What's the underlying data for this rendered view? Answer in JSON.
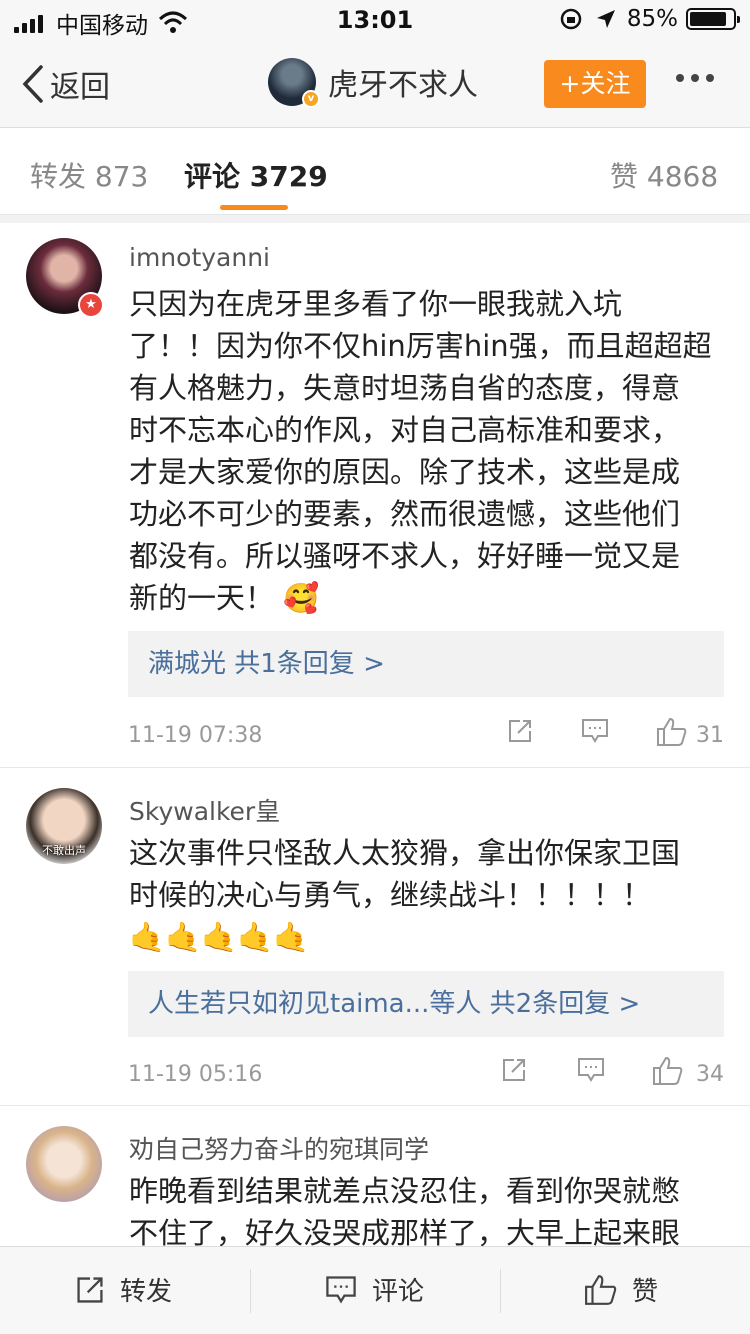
{
  "status_bar": {
    "carrier": "中国移动",
    "time": "13:01",
    "battery_percent": "85%",
    "battery_level": 0.85
  },
  "nav": {
    "back_label": "返回",
    "title": "虎牙不求人",
    "follow_label": "+关注",
    "verified_badge": "v"
  },
  "tabs": {
    "repost_label": "转发",
    "repost_count": "873",
    "comments_label": "评论",
    "comments_count": "3729",
    "likes_label": "赞",
    "likes_count": "4868"
  },
  "comments": [
    {
      "username": "imnotyanni",
      "lines": [
        "只因为在虎牙里多看了你一眼我就入坑",
        "了！！因为你不仅hin厉害hin强，而且超超超",
        "有人格魅力，失意时坦荡自省的态度，得意",
        "时不忘本心的作风，对自己高标准和要求，",
        "才是大家爱你的原因。除了技术，这些是成",
        "功必不可少的要素，然而很遗憾，这些他们",
        "都没有。所以骚呀不求人，好好睡一觉又是",
        "新的一天！"
      ],
      "emoji": "🥰",
      "reply": "满城光  共1条回复 >",
      "time": "11-19 07:38",
      "likes": "31"
    },
    {
      "username": "Skywalker皇",
      "avatar_caption": "不敢出声",
      "lines": [
        "这次事件只怪敌人太狡猾，拿出你保家卫国",
        "时候的决心与勇气，继续战斗！！！！！"
      ],
      "emoji_line": "🤙🤙🤙🤙🤙",
      "reply": "人生若只如初见taima...等人  共2条回复 >",
      "time": "11-19 05:16",
      "likes": "34"
    },
    {
      "username": "劝自己努力奋斗的宛琪同学",
      "lines": [
        "昨晚看到结果就差点没忍住，看到你哭就憋",
        "不住了，好久没哭成那样了，大早上起来眼"
      ]
    }
  ],
  "bottom_bar": {
    "repost": "转发",
    "comment": "评论",
    "like": "赞"
  },
  "colors": {
    "accent": "#f98a1e",
    "link": "#4a6f9c"
  }
}
